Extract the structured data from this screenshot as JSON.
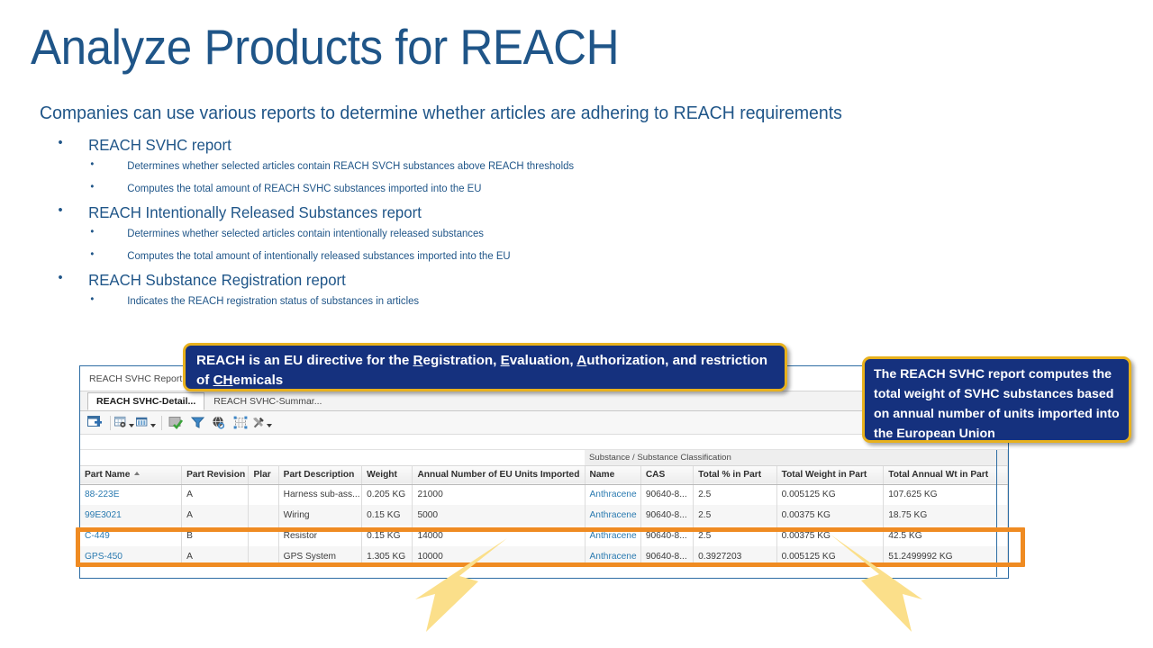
{
  "slide": {
    "title": "Analyze Products for REACH",
    "subtitle": "Companies can use various reports to determine whether articles are adhering to REACH  requirements",
    "accent_blue": "#1f5588",
    "callout_navy": "#15317e",
    "callout_border_gold": "#e8b11d",
    "highlight_orange": "#ef8b22"
  },
  "bullets": [
    {
      "label": "REACH  SVHC report",
      "sub": [
        "Determines  whether  selected  articles  contain   REACH SVCH substances  above  REACH thresholds",
        "Computes  the  total  amount  of REACH SVHC substances  imported  into  the  EU"
      ]
    },
    {
      "label": "REACH  Intentionally  Released  Substances report",
      "sub": [
        "Determines  whether  selected  articles  contain  intentionally   released  substances",
        "Computes  the  total  amount  of intentionally   released  substances  imported  into the  EU"
      ]
    },
    {
      "label": "REACH  Substance  Registration report",
      "sub": [
        "Indicates  the  REACH registration  status  of substances  in articles"
      ]
    }
  ],
  "callouts": {
    "left": {
      "line1_a": "REACH is an EU directive for the ",
      "line1_r": "R",
      "line1_b": "egistration, ",
      "line1_e": "E",
      "line1_c": "valuation, ",
      "line1_a2": "A",
      "line1_d": "uthorization, and",
      "line2_a": "restriction of ",
      "line2_ch": "CH",
      "line2_b": "emicals"
    },
    "right": {
      "text": "The REACH  SVHC report computes the total weight of SVHC substances based on annual number of units imported into the European Union"
    }
  },
  "report_window": {
    "title": "REACH SVHC Report",
    "tabs": [
      {
        "label": "REACH SVHC-Detail...",
        "active": true
      },
      {
        "label": "REACH SVHC-Summar...",
        "active": false
      }
    ],
    "toolbar": [
      {
        "name": "new-report-icon",
        "caret": false
      },
      {
        "name": "table-settings-icon",
        "caret": true
      },
      {
        "name": "columns-icon",
        "caret": true
      },
      {
        "name": "apply-check-icon",
        "caret": false
      },
      {
        "name": "filter-funnel-icon",
        "caret": false
      },
      {
        "name": "globe-search-icon",
        "caret": false
      },
      {
        "name": "select-grid-icon",
        "caret": false
      },
      {
        "name": "tools-icon",
        "caret": true
      }
    ],
    "group_header": "Substance / Substance Classification",
    "columns": [
      "Part Name",
      "Part Revision",
      "Plar",
      "Part Description",
      "Weight",
      "Annual Number of EU Units Imported",
      "Name",
      "CAS",
      "Total % in Part",
      "Total Weight in Part",
      "Total Annual Wt in Part"
    ],
    "sorted_column": "Part Name",
    "rows": [
      {
        "part_name": "88-223E",
        "part_revision": "A",
        "plant": "",
        "part_description": "Harness sub-ass...",
        "weight": "0.205 KG",
        "annual_units": "21000",
        "substance_name": "Anthracene",
        "cas": "90640-8...",
        "total_pct": "2.5",
        "total_weight": "0.005125 KG",
        "total_annual_wt": "107.625 KG"
      },
      {
        "part_name": "99E3021",
        "part_revision": "A",
        "plant": "",
        "part_description": "Wiring",
        "weight": "0.15 KG",
        "annual_units": "5000",
        "substance_name": "Anthracene",
        "cas": "90640-8...",
        "total_pct": "2.5",
        "total_weight": "0.00375 KG",
        "total_annual_wt": "18.75 KG"
      },
      {
        "part_name": "C-449",
        "part_revision": "B",
        "plant": "",
        "part_description": "Resistor",
        "weight": "0.15 KG",
        "annual_units": "14000",
        "substance_name": "Anthracene",
        "cas": "90640-8...",
        "total_pct": "2.5",
        "total_weight": "0.00375 KG",
        "total_annual_wt": "42.5 KG"
      },
      {
        "part_name": "GPS-450",
        "part_revision": "A",
        "plant": "",
        "part_description": "GPS System",
        "weight": "1.305 KG",
        "annual_units": "10000",
        "substance_name": "Anthracene",
        "cas": "90640-8...",
        "total_pct": "0.3927203",
        "total_weight": "0.005125 KG",
        "total_annual_wt": "51.2499992 KG"
      }
    ]
  }
}
